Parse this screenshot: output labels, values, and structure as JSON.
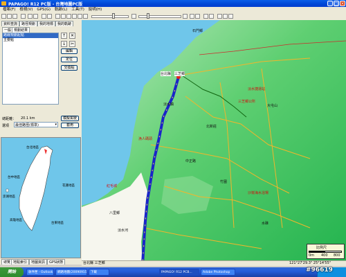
{
  "window": {
    "title": "PAPAGO! R12 PC版 - 台灣地圖PC版"
  },
  "menu": [
    "檔案(F)",
    "檢視(V)",
    "GPS(G)",
    "軌跡(L)",
    "工具(T)",
    "說明(H)"
  ],
  "left_tabs": [
    "資料查詢",
    "路徑規劃",
    "我的地標",
    "我的軌跡"
  ],
  "sub_tabs": [
    "一般",
    "規劃結果"
  ],
  "route_list": [
    "路線規劃起點",
    "主要點"
  ],
  "buttons": {
    "edit": "編輯",
    "locate": "定位",
    "exchange": "交換點",
    "simulate": "模擬駕駛",
    "apply": "套用"
  },
  "total_distance": {
    "label": "總距離：",
    "value": "20.1 km"
  },
  "route_option": {
    "label": "選項",
    "value": "最佳路徑(標準)"
  },
  "overview_labels": [
    "台北地區",
    "台中地區",
    "花蓮地區",
    "高雄地區",
    "台東地區",
    "澎湖地區"
  ],
  "bottom_tabs": [
    "總覽",
    "地點索引",
    "地圖資訊",
    "GPS狀態"
  ],
  "map_labels_black": [
    "台北縣",
    "三芝鄉",
    "淡水鎮",
    "石門鄉",
    "北新莊",
    "中正路",
    "八里鄉",
    "大屯山",
    "竹圍",
    "水碓",
    "淡水河"
  ],
  "map_labels_red": [
    "淡水捷運站",
    "三芝鄉公所",
    "漁人碼頭",
    "紅毛城",
    "沙崙海水浴場"
  ],
  "statusbar": {
    "location": "台北縣 三芝鄉",
    "coords": "121°27'29.3\"  25°14'55\""
  },
  "scale": {
    "label": "比例尺",
    "left": "0m",
    "mid": "400",
    "right": "800"
  },
  "taskbar": {
    "start": "開始",
    "tasks": [
      "收件匣 - Outlook",
      "網路地圖(20090915...",
      "下載",
      "PAPAGO! R12 PCB...",
      "Adobe Photoshop"
    ],
    "clock": "下午 02:25"
  },
  "watermark": "#96619",
  "colors": {
    "route": "#1a24c8",
    "sea": "#6fc6ea",
    "land": "#3fc36a",
    "titlebar": "#0046d5"
  }
}
